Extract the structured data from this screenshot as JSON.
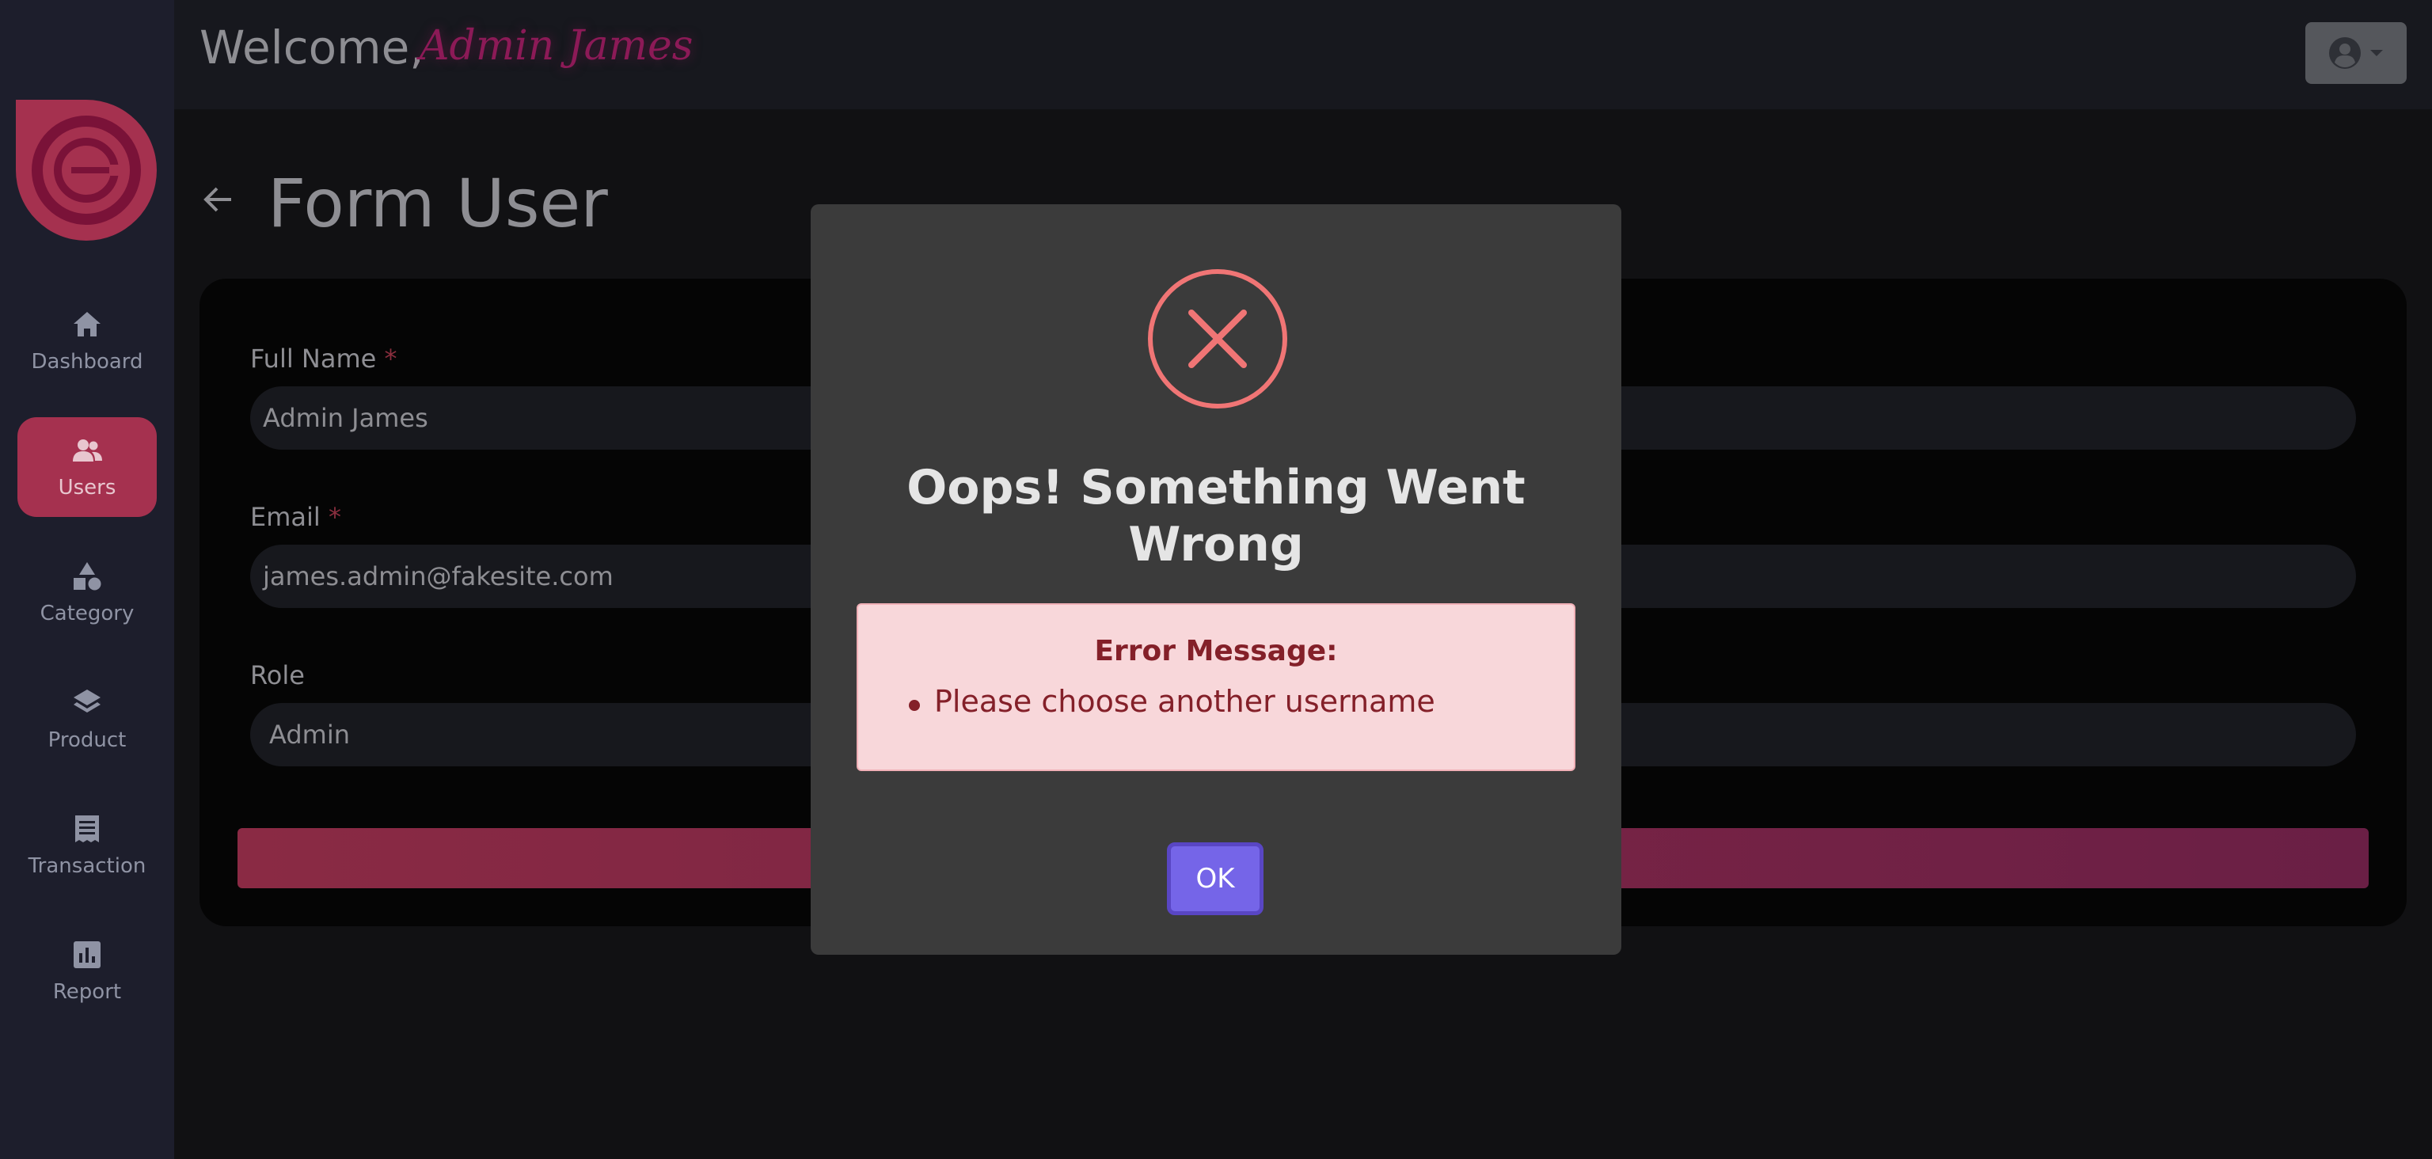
{
  "header": {
    "welcome_label": "Welcome,",
    "user_name": "Admin James"
  },
  "sidebar": {
    "items": [
      {
        "label": "Dashboard",
        "icon": "home-icon"
      },
      {
        "label": "Users",
        "icon": "users-icon",
        "active": true
      },
      {
        "label": "Category",
        "icon": "shapes-icon"
      },
      {
        "label": "Product",
        "icon": "layers-icon"
      },
      {
        "label": "Transaction",
        "icon": "receipt-icon"
      },
      {
        "label": "Report",
        "icon": "chart-icon"
      }
    ]
  },
  "page": {
    "title": "Form User"
  },
  "form": {
    "full_name": {
      "label": "Full Name",
      "required_mark": "*",
      "value": "Admin James"
    },
    "email": {
      "label": "Email",
      "required_mark": "*",
      "value": "james.admin@fakesite.com"
    },
    "role": {
      "label": "Role",
      "value": "Admin"
    }
  },
  "modal": {
    "title": "Oops! Something Went Wrong",
    "error_heading": "Error Message:",
    "errors": [
      "Please choose another username"
    ],
    "ok_label": "OK"
  },
  "colors": {
    "accent": "#a5314f",
    "ok_button": "#7565e8",
    "error_icon": "#f07575",
    "error_bg": "#f8d7da",
    "error_text": "#842029"
  }
}
